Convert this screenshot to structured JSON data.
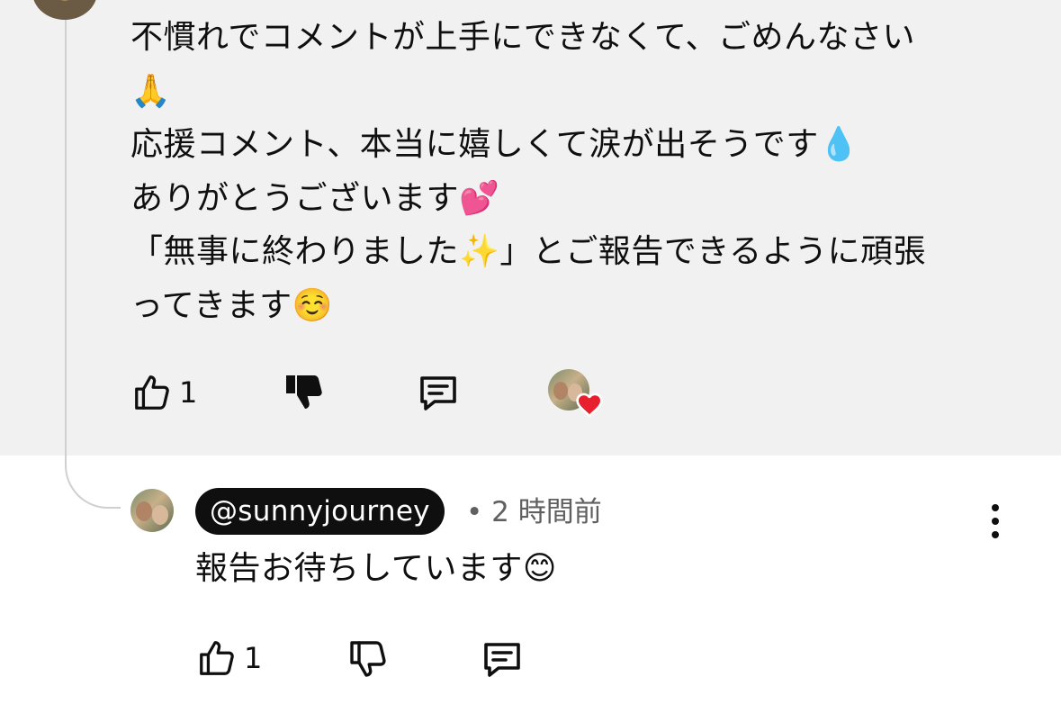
{
  "parent_comment": {
    "text": "不慣れでコメントが上手にできなくて、ごめんなさい\n🙏\n応援コメント、本当に嬉しくて涙が出そうです💧\nありがとうございます💕\n「無事に終わりました✨」とご報告できるように頑張\nってきます☺️",
    "like_count": "1"
  },
  "reply": {
    "author_handle": "@sunnyjourney",
    "separator": "•",
    "timestamp": "2 時間前",
    "text": "報告お待ちしています😊",
    "like_count": "1"
  },
  "icons": {
    "like": "thumbs-up-icon",
    "dislike": "thumbs-down-icon",
    "reply": "comment-icon",
    "creator_heart": "heart-icon",
    "menu": "more-vertical-icon"
  },
  "colors": {
    "highlight_bg": "#f1f1f1",
    "heart": "#e8202e",
    "handle_pill": "#0f0f0f",
    "meta_text": "#606060"
  }
}
